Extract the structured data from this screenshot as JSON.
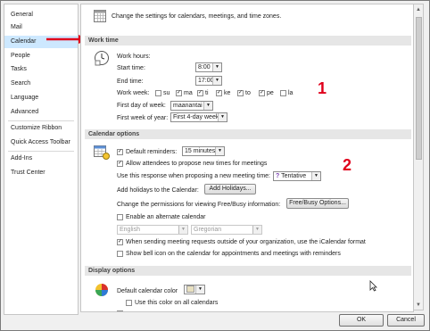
{
  "sidebar": {
    "items": [
      {
        "label": "General"
      },
      {
        "label": "Mail"
      },
      {
        "label": "Calendar"
      },
      {
        "label": "People"
      },
      {
        "label": "Tasks"
      },
      {
        "label": "Search"
      },
      {
        "label": "Language"
      },
      {
        "label": "Advanced"
      },
      {
        "label": "Customize Ribbon"
      },
      {
        "label": "Quick Access Toolbar"
      },
      {
        "label": "Add-Ins"
      },
      {
        "label": "Trust Center"
      }
    ],
    "selected": "Calendar"
  },
  "header": {
    "description": "Change the settings for calendars, meetings, and time zones."
  },
  "work_time": {
    "title": "Work time",
    "work_hours_label": "Work hours:",
    "start_time_label": "Start time:",
    "start_time_value": "8:00",
    "end_time_label": "End time:",
    "end_time_value": "17:00",
    "work_week_label": "Work week:",
    "days": [
      {
        "label": "su",
        "checked": false
      },
      {
        "label": "ma",
        "checked": true
      },
      {
        "label": "ti",
        "checked": true
      },
      {
        "label": "ke",
        "checked": true
      },
      {
        "label": "to",
        "checked": true
      },
      {
        "label": "pe",
        "checked": true
      },
      {
        "label": "la",
        "checked": false
      }
    ],
    "first_day_label": "First day of week:",
    "first_day_value": "maanantai",
    "first_week_label": "First week of year:",
    "first_week_value": "First 4-day week"
  },
  "calendar_options": {
    "title": "Calendar options",
    "default_reminders_label": "Default reminders:",
    "default_reminders_value": "15 minutes",
    "allow_attendees_label": "Allow attendees to propose new times for meetings",
    "use_response_label": "Use this response when proposing a new meeting time:",
    "response_value": "Tentative",
    "response_icon_text": "?",
    "add_holidays_label": "Add holidays to the Calendar:",
    "add_holidays_button": "Add Holidays...",
    "free_busy_label": "Change the permissions for viewing Free/Busy information:",
    "free_busy_button": "Free/Busy Options...",
    "alt_calendar_label": "Enable an alternate calendar",
    "alt_language_value": "English",
    "alt_calendar_value": "Gregorian",
    "icalendar_label": "When sending meeting requests outside of your organization, use the iCalendar format",
    "bell_icon_label": "Show bell icon on the calendar for appointments and meetings with reminders"
  },
  "display_options": {
    "title": "Display options",
    "default_color_label": "Default calendar color",
    "use_color_all_label": "Use this color on all calendars"
  },
  "annotations": {
    "one": "1",
    "two": "2"
  },
  "footer": {
    "ok_label": "OK",
    "cancel_label": "Cancel"
  },
  "colors": {
    "selected_nav": "#cde8ff",
    "annotation_red": "#e0001b",
    "section_bg": "#e6e6e6"
  }
}
